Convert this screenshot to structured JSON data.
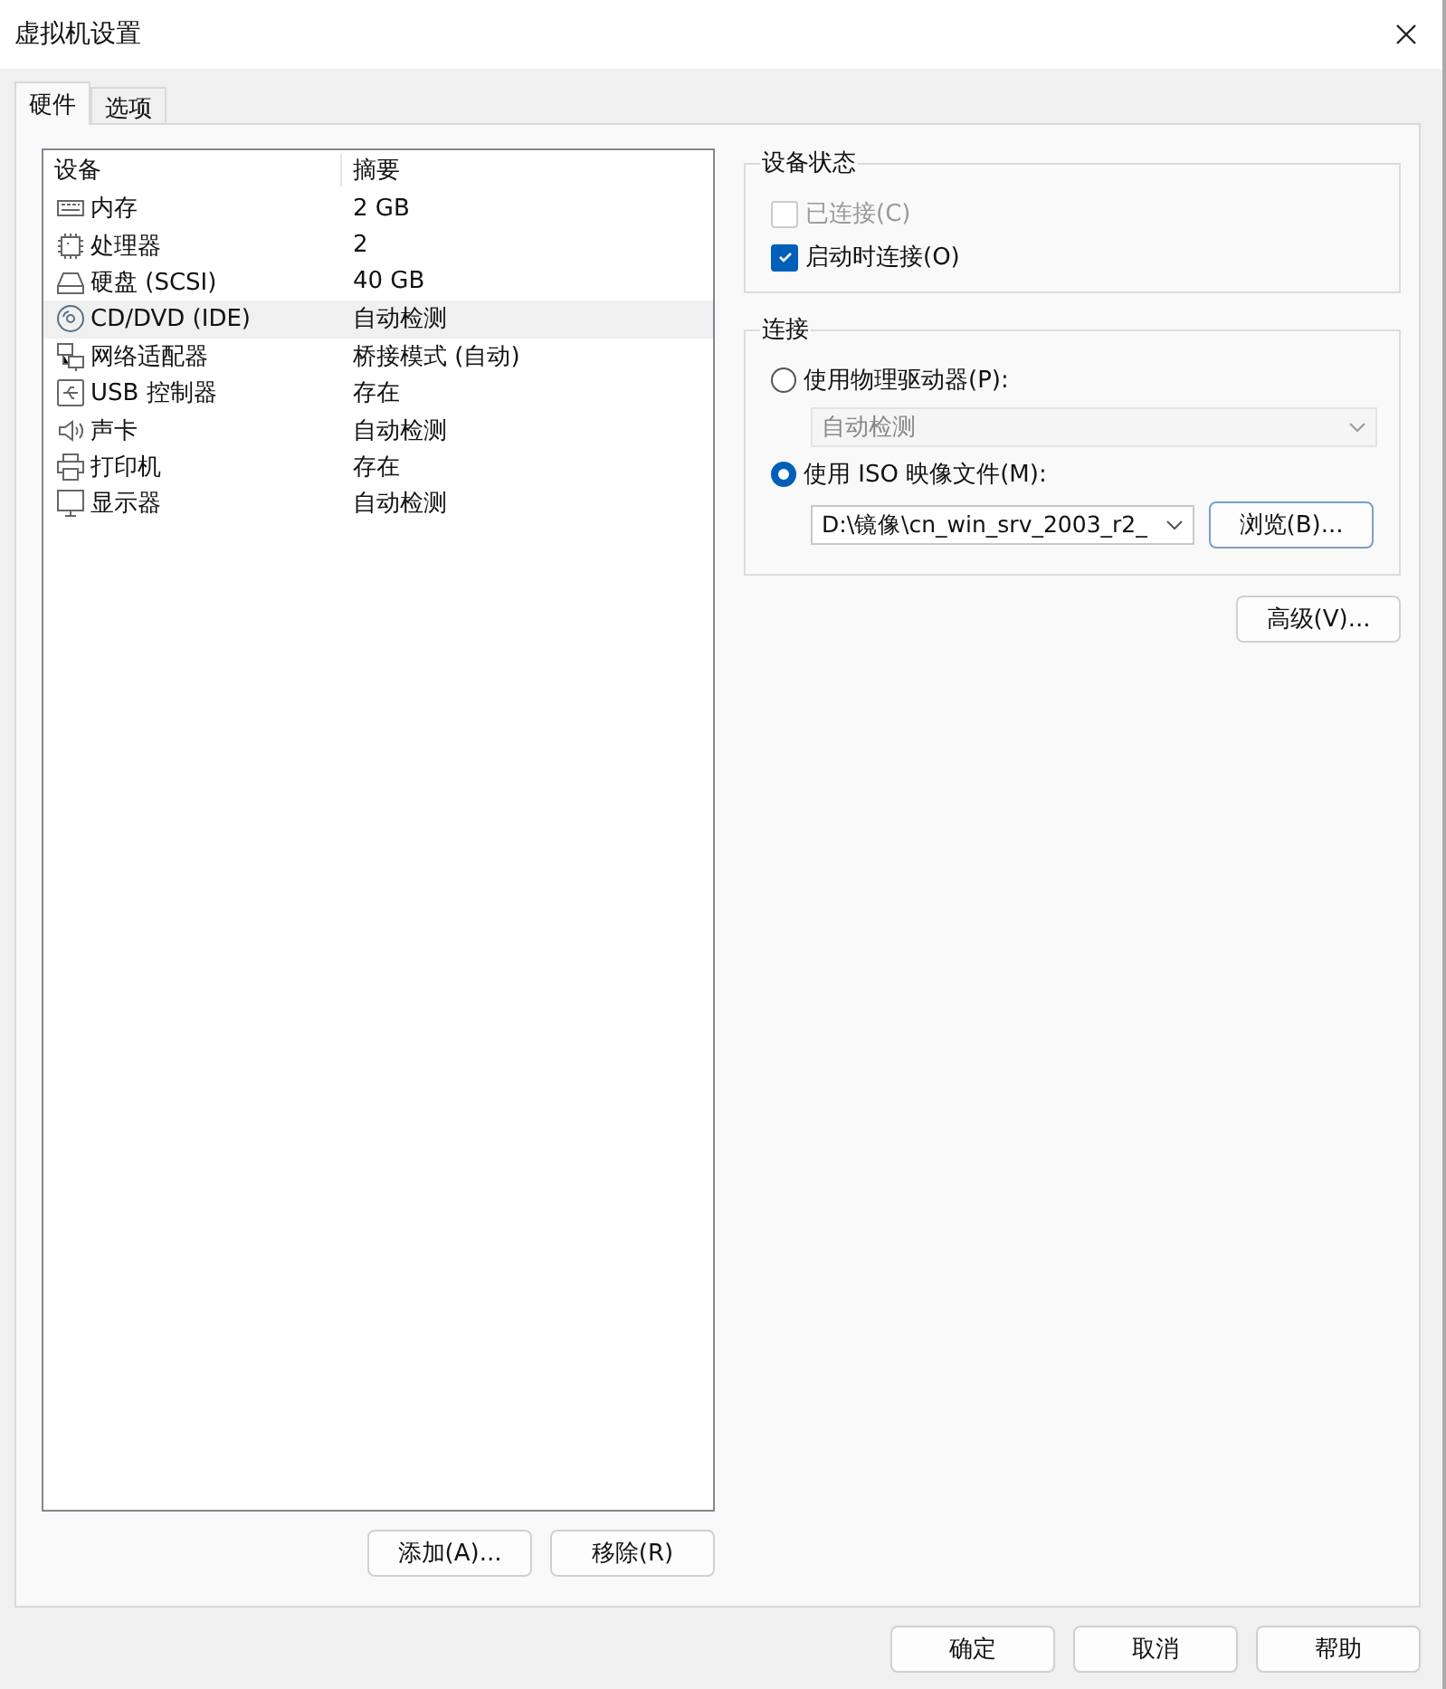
{
  "window": {
    "title": "虚拟机设置"
  },
  "tabs": [
    {
      "label": "硬件",
      "selected": true
    },
    {
      "label": "选项",
      "selected": false
    }
  ],
  "devices": {
    "columns": [
      "设备",
      "摘要"
    ],
    "rows": [
      {
        "kind": "memory",
        "name": "内存",
        "summary": "2 GB",
        "selected": false
      },
      {
        "kind": "cpu",
        "name": "处理器",
        "summary": "2",
        "selected": false
      },
      {
        "kind": "disk",
        "name": "硬盘 (SCSI)",
        "summary": "40 GB",
        "selected": false
      },
      {
        "kind": "cd",
        "name": "CD/DVD (IDE)",
        "summary": "自动检测",
        "selected": true
      },
      {
        "kind": "network",
        "name": "网络适配器",
        "summary": "桥接模式 (自动)",
        "selected": false
      },
      {
        "kind": "usb",
        "name": "USB 控制器",
        "summary": "存在",
        "selected": false
      },
      {
        "kind": "sound",
        "name": "声卡",
        "summary": "自动检测",
        "selected": false
      },
      {
        "kind": "printer",
        "name": "打印机",
        "summary": "存在",
        "selected": false
      },
      {
        "kind": "display",
        "name": "显示器",
        "summary": "自动检测",
        "selected": false
      }
    ]
  },
  "device_buttons": [
    "添加(A)...",
    "移除(R)"
  ],
  "device_status": {
    "title": "设备状态",
    "items": [
      {
        "label": "已连接(C)",
        "checked": false,
        "disabled": true
      },
      {
        "label": "启动时连接(O)",
        "checked": true,
        "disabled": false
      }
    ]
  },
  "connection": {
    "title": "连接",
    "physical": {
      "label": "使用物理驱动器(P):",
      "selected": false,
      "drive": "自动检测"
    },
    "iso": {
      "label": "使用 ISO 映像文件(M):",
      "selected": true,
      "path": "D:\\镜像\\cn_win_srv_2003_r2_",
      "browse": "浏览(B)..."
    }
  },
  "advanced_button": "高级(V)...",
  "footer_buttons": [
    "确定",
    "取消",
    "帮助"
  ]
}
